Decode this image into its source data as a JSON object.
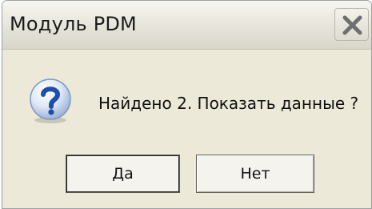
{
  "dialog": {
    "title": "Модуль PDM",
    "message": "Найдено 2. Показать данные ?",
    "icon": "question-icon",
    "buttons": {
      "yes_label": "Да",
      "no_label": "Нет"
    },
    "colors": {
      "window_bg": "#ece9d8",
      "close_icon": "#6f6f6f",
      "question_icon": "#1d4fa8"
    }
  }
}
